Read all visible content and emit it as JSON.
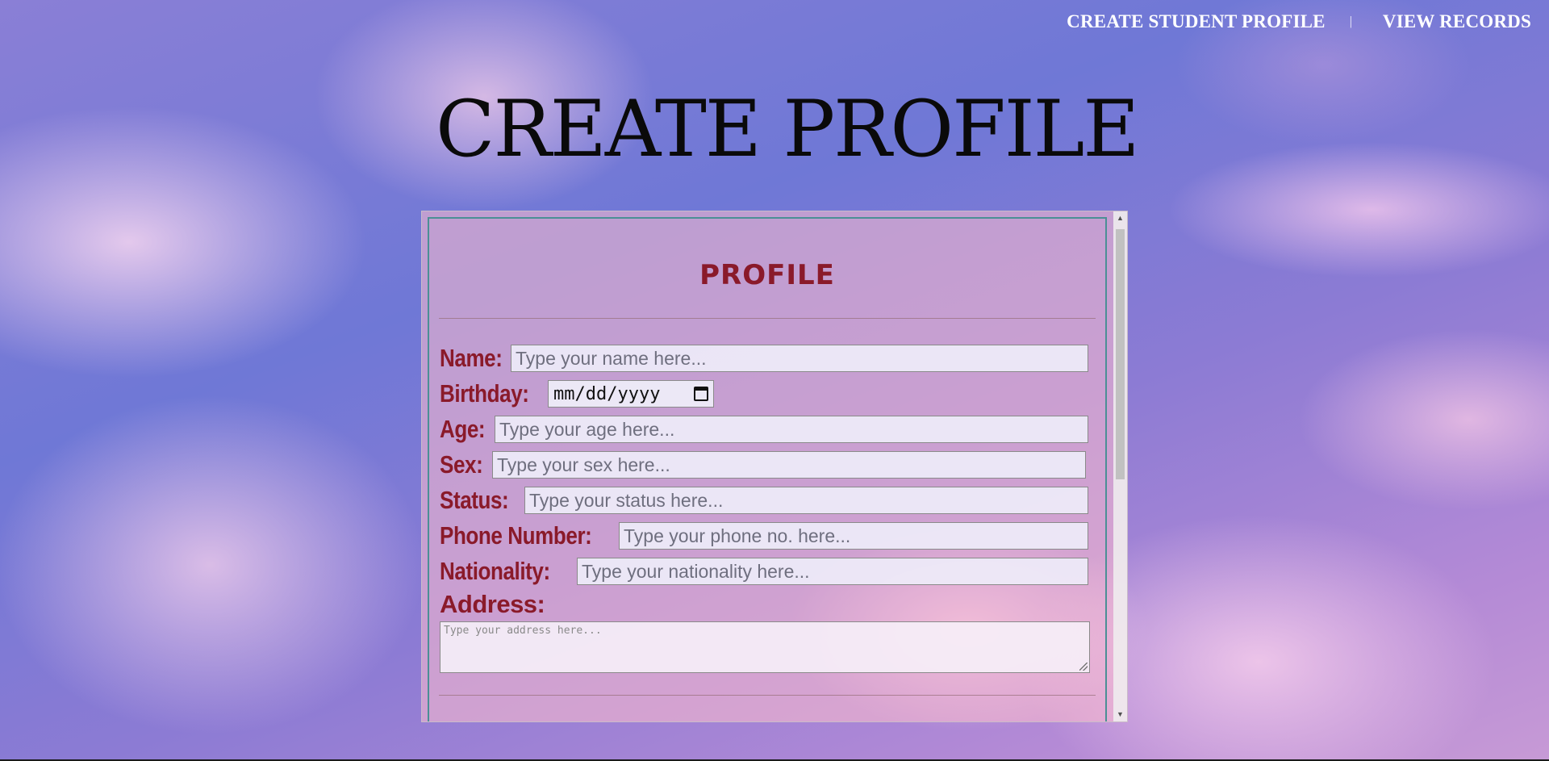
{
  "nav": {
    "create_label": "CREATE STUDENT PROFILE",
    "separator": "|",
    "records_label": "VIEW RECORDS"
  },
  "page_title": "CREATE PROFILE",
  "form": {
    "heading": "PROFILE",
    "fields": {
      "name": {
        "label": "Name:",
        "placeholder": "Type your name here..."
      },
      "birthday": {
        "label": "Birthday:",
        "value": "mm/dd/yyyy"
      },
      "age": {
        "label": "Age:",
        "placeholder": "Type your age here..."
      },
      "sex": {
        "label": "Sex:",
        "placeholder": "Type your sex here..."
      },
      "status": {
        "label": "Status:",
        "placeholder": "Type your status here..."
      },
      "phone": {
        "label": "Phone Number:",
        "placeholder": "Type your phone no. here..."
      },
      "nationality": {
        "label": "Nationality:",
        "placeholder": "Type your nationality here..."
      },
      "address": {
        "label": "Address:",
        "placeholder": "Type your address here..."
      }
    }
  },
  "icons": {
    "calendar": "calendar-icon",
    "scroll_up": "chevron-up-icon",
    "scroll_down": "chevron-down-icon"
  },
  "colors": {
    "label": "#8a1a2a",
    "panel_border": "#4b8f95",
    "nav_text": "#ffffff"
  }
}
